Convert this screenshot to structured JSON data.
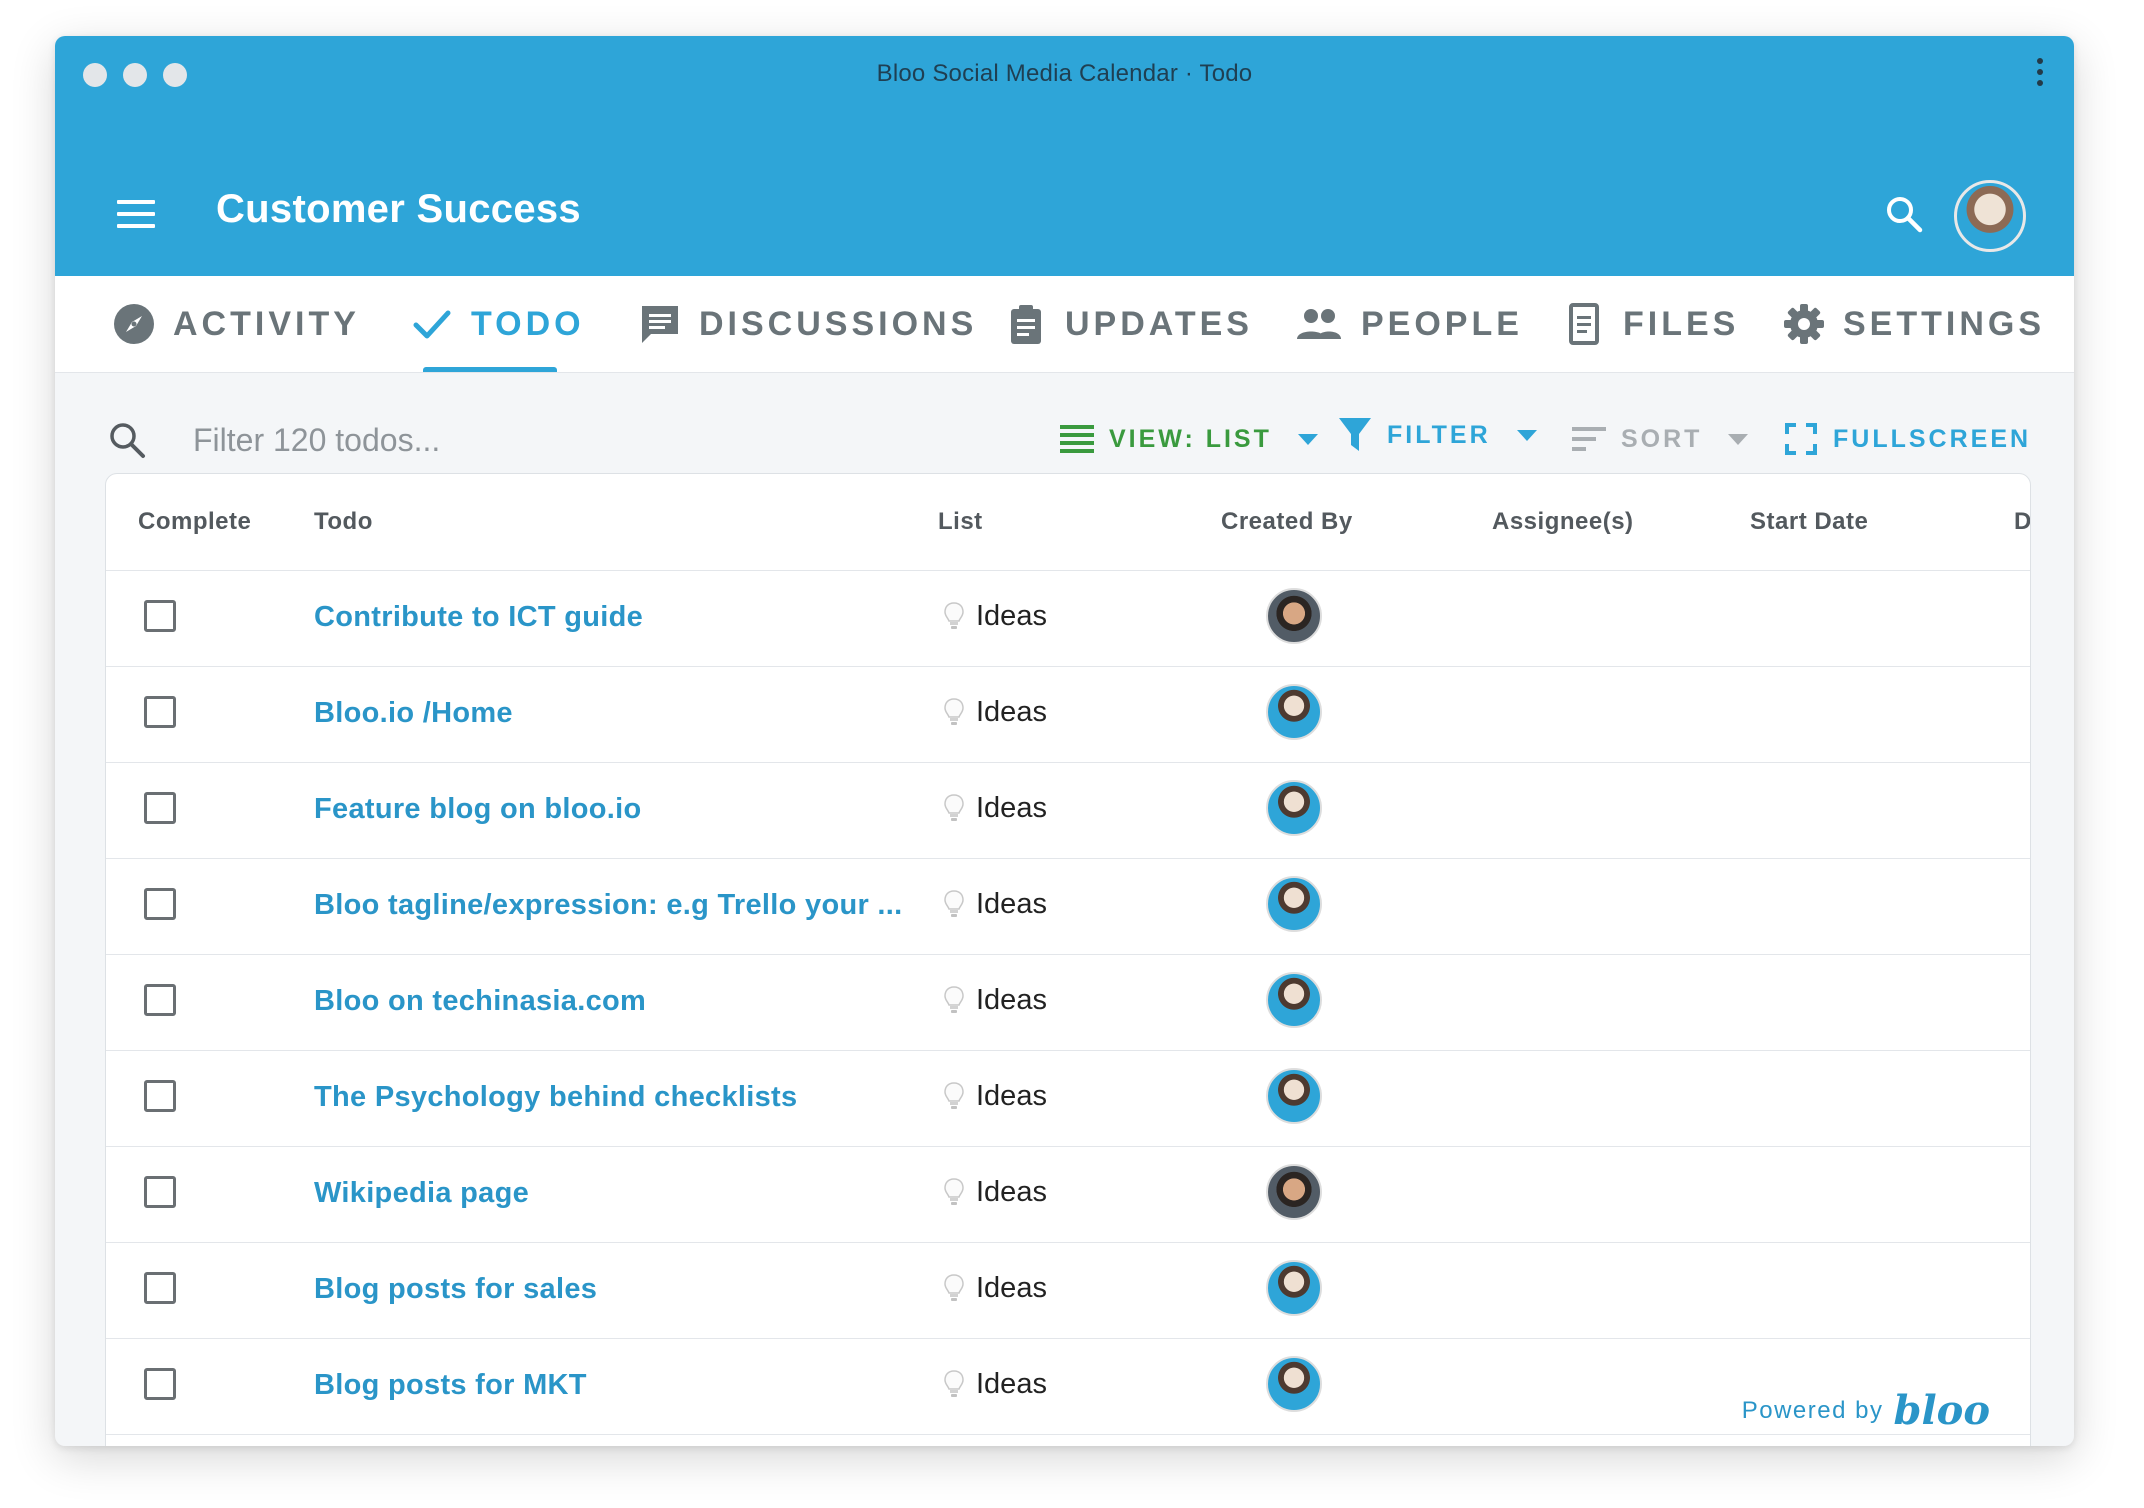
{
  "window": {
    "title": "Bloo Social Media Calendar · Todo"
  },
  "header": {
    "title": "Customer Success"
  },
  "tabs": [
    {
      "label": "ACTIVITY",
      "icon": "compass-icon"
    },
    {
      "label": "TODO",
      "icon": "check-icon",
      "active": true
    },
    {
      "label": "DISCUSSIONS",
      "icon": "chat-icon"
    },
    {
      "label": "UPDATES",
      "icon": "clipboard-icon"
    },
    {
      "label": "PEOPLE",
      "icon": "people-icon"
    },
    {
      "label": "FILES",
      "icon": "file-icon"
    },
    {
      "label": "SETTINGS",
      "icon": "gear-icon"
    }
  ],
  "toolbar": {
    "filter_placeholder": "Filter 120 todos...",
    "view_label": "VIEW: LIST",
    "filter_label": "FILTER",
    "sort_label": "SORT",
    "fullscreen_label": "FULLSCREEN"
  },
  "table": {
    "columns": [
      "Complete",
      "Todo",
      "List",
      "Created By",
      "Assignee(s)",
      "Start Date",
      "D"
    ],
    "rows": [
      {
        "todo": "Contribute to ICT guide",
        "list": "Ideas",
        "creator_avatar": "dark"
      },
      {
        "todo": "Bloo.io /Home",
        "list": "Ideas",
        "creator_avatar": "blue"
      },
      {
        "todo": "Feature blog on bloo.io",
        "list": "Ideas",
        "creator_avatar": "blue"
      },
      {
        "todo": "Bloo tagline/expression: e.g Trello your ...",
        "list": "Ideas",
        "creator_avatar": "blue"
      },
      {
        "todo": "Bloo on techinasia.com",
        "list": "Ideas",
        "creator_avatar": "blue"
      },
      {
        "todo": "The Psychology behind checklists",
        "list": "Ideas",
        "creator_avatar": "blue"
      },
      {
        "todo": "Wikipedia page",
        "list": "Ideas",
        "creator_avatar": "dark"
      },
      {
        "todo": "Blog posts for sales",
        "list": "Ideas",
        "creator_avatar": "blue"
      },
      {
        "todo": "Blog posts for MKT",
        "list": "Ideas",
        "creator_avatar": "blue"
      }
    ]
  },
  "footer": {
    "powered_label": "Powered by",
    "logo_text": "bloo"
  },
  "colors": {
    "brand": "#2ea5d8",
    "link": "#2a95c8",
    "view_green": "#3a9a3e",
    "sort_gray": "#a9aeb2"
  }
}
